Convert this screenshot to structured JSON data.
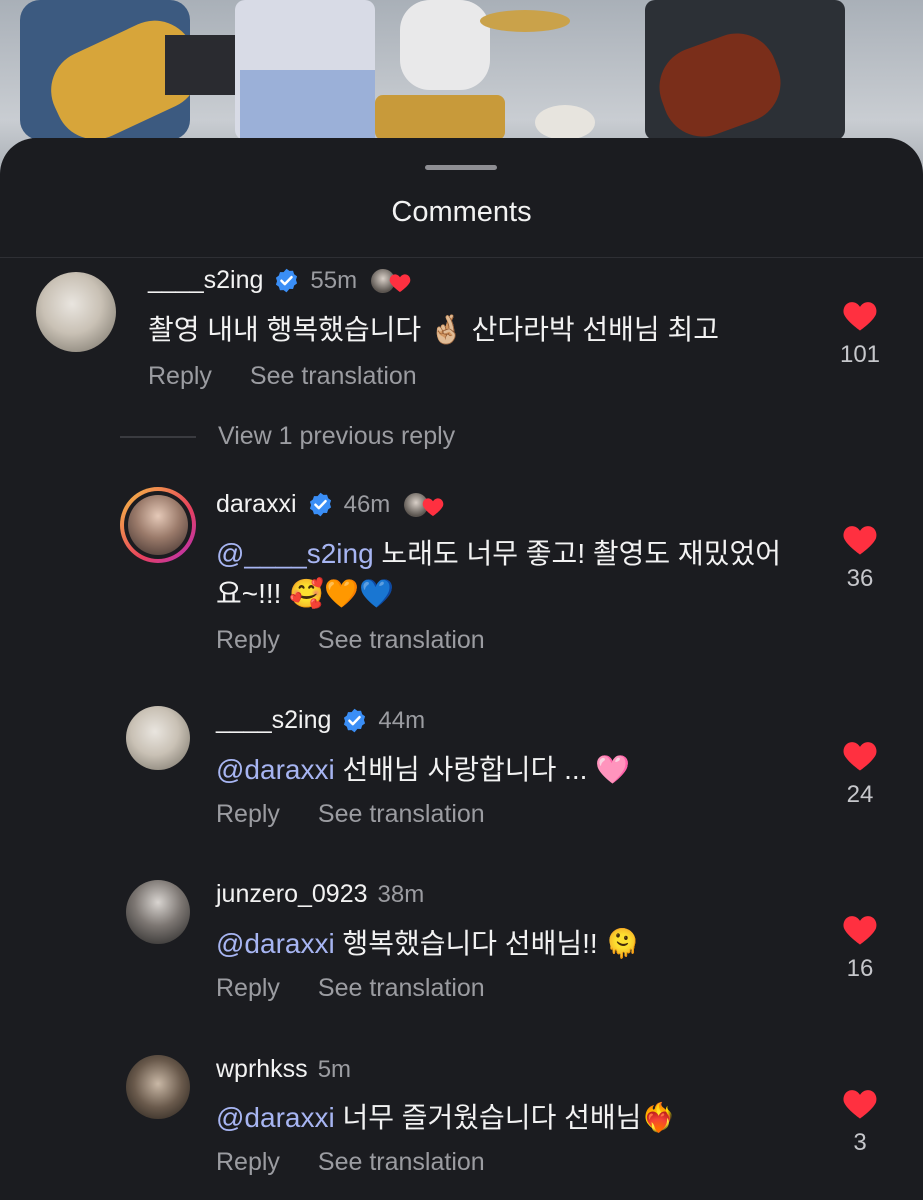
{
  "sheet_title": "Comments",
  "view_replies": "View 1 previous reply",
  "colors": {
    "background": "#1b1c20",
    "mention": "#a7b5f2",
    "like": "#ff3040",
    "verified": "#3a8ef6"
  },
  "comments": [
    {
      "username": "____s2ing",
      "verified": true,
      "time": "55m",
      "creator_liked": true,
      "mention": "",
      "text": "촬영 내내 행복했습니다 🤞🏼 산다라박 선배님 최고",
      "reply_label": "Reply",
      "translate_label": "See translation",
      "likes": "101"
    },
    {
      "username": "daraxxi",
      "verified": true,
      "time": "46m",
      "creator_liked": true,
      "mention": "@____s2ing",
      "text": " 노래도 너무 좋고! 촬영도 재밌었어요~!!! 🥰🧡💙",
      "reply_label": "Reply",
      "translate_label": "See translation",
      "likes": "36"
    },
    {
      "username": "____s2ing",
      "verified": true,
      "time": "44m",
      "creator_liked": false,
      "mention": "@daraxxi",
      "text": " 선배님 사랑합니다 ... 🩷",
      "reply_label": "Reply",
      "translate_label": "See translation",
      "likes": "24"
    },
    {
      "username": "junzero_0923",
      "verified": false,
      "time": "38m",
      "creator_liked": false,
      "mention": "@daraxxi",
      "text": " 행복했습니다 선배님!! 🫠",
      "reply_label": "Reply",
      "translate_label": "See translation",
      "likes": "16"
    },
    {
      "username": "wprhkss",
      "verified": false,
      "time": "5m",
      "creator_liked": false,
      "mention": "@daraxxi",
      "text": " 너무 즐거웠습니다 선배님❤️‍🔥",
      "reply_label": "Reply",
      "translate_label": "See translation",
      "likes": "3"
    }
  ]
}
